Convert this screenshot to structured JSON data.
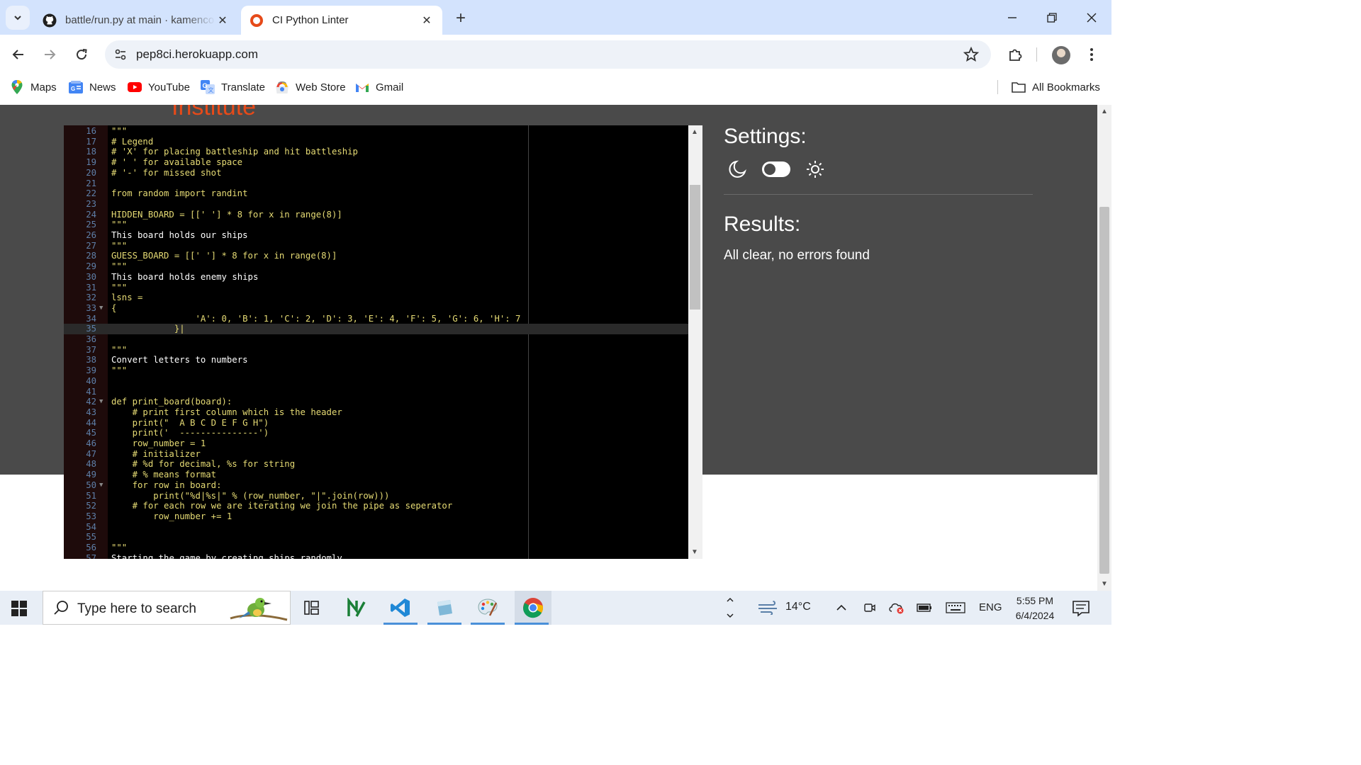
{
  "tabs": [
    {
      "title": "battle/run.py at main · kamenco",
      "icon": "github-icon"
    },
    {
      "title": "CI Python Linter",
      "icon": "ci-linter-icon"
    }
  ],
  "toolbar": {
    "url": "pep8ci.herokuapp.com"
  },
  "bookmarks": [
    {
      "label": "Maps"
    },
    {
      "label": "News"
    },
    {
      "label": "YouTube"
    },
    {
      "label": "Translate"
    },
    {
      "label": "Web Store"
    },
    {
      "label": "Gmail"
    }
  ],
  "bookmarks_all": "All Bookmarks",
  "page": {
    "brand_partial": "Institute",
    "settings_title": "Settings:",
    "results_title": "Results:",
    "results_text": "All clear, no errors found"
  },
  "editor": {
    "current_line": 35,
    "lines": [
      {
        "n": 16,
        "t": "\"\"\""
      },
      {
        "n": 17,
        "t": "# Legend"
      },
      {
        "n": 18,
        "t": "# 'X' for placing battleship and hit battleship"
      },
      {
        "n": 19,
        "t": "# ' ' for available space"
      },
      {
        "n": 20,
        "t": "# '-' for missed shot"
      },
      {
        "n": 21,
        "t": ""
      },
      {
        "n": 22,
        "t": "from random import randint"
      },
      {
        "n": 23,
        "t": ""
      },
      {
        "n": 24,
        "t": "HIDDEN_BOARD = [[' '] * 8 for x in range(8)]"
      },
      {
        "n": 25,
        "t": "\"\"\""
      },
      {
        "n": 26,
        "t": "This board holds our ships"
      },
      {
        "n": 27,
        "t": "\"\"\""
      },
      {
        "n": 28,
        "t": "GUESS_BOARD = [[' '] * 8 for x in range(8)]"
      },
      {
        "n": 29,
        "t": "\"\"\""
      },
      {
        "n": 30,
        "t": "This board holds enemy ships"
      },
      {
        "n": 31,
        "t": "\"\"\""
      },
      {
        "n": 32,
        "t": "lsns ="
      },
      {
        "n": 33,
        "t": "{",
        "fold": true
      },
      {
        "n": 34,
        "t": "                'A': 0, 'B': 1, 'C': 2, 'D': 3, 'E': 4, 'F': 5, 'G': 6, 'H': 7"
      },
      {
        "n": 35,
        "t": "            }|"
      },
      {
        "n": 36,
        "t": ""
      },
      {
        "n": 37,
        "t": "\"\"\""
      },
      {
        "n": 38,
        "t": "Convert letters to numbers"
      },
      {
        "n": 39,
        "t": "\"\"\""
      },
      {
        "n": 40,
        "t": ""
      },
      {
        "n": 41,
        "t": ""
      },
      {
        "n": 42,
        "t": "def print_board(board):",
        "fold": true
      },
      {
        "n": 43,
        "t": "    # print first column which is the header"
      },
      {
        "n": 44,
        "t": "    print(\"  A B C D E F G H\")"
      },
      {
        "n": 45,
        "t": "    print('  ---------------')"
      },
      {
        "n": 46,
        "t": "    row_number = 1"
      },
      {
        "n": 47,
        "t": "    # initializer"
      },
      {
        "n": 48,
        "t": "    # %d for decimal, %s for string"
      },
      {
        "n": 49,
        "t": "    # % means format"
      },
      {
        "n": 50,
        "t": "    for row in board:",
        "fold": true
      },
      {
        "n": 51,
        "t": "        print(\"%d|%s|\" % (row_number, \"|\".join(row)))"
      },
      {
        "n": 52,
        "t": "    # for each row we are iterating we join the pipe as seperator"
      },
      {
        "n": 53,
        "t": "        row_number += 1"
      },
      {
        "n": 54,
        "t": ""
      },
      {
        "n": 55,
        "t": ""
      },
      {
        "n": 56,
        "t": "\"\"\""
      },
      {
        "n": 57,
        "t": "Starting the game by creating ships randomly"
      }
    ]
  },
  "taskbar": {
    "search_placeholder": "Type here to search",
    "temperature": "14°C",
    "language": "ENG",
    "time": "5:55 PM",
    "date": "6/4/2024"
  }
}
